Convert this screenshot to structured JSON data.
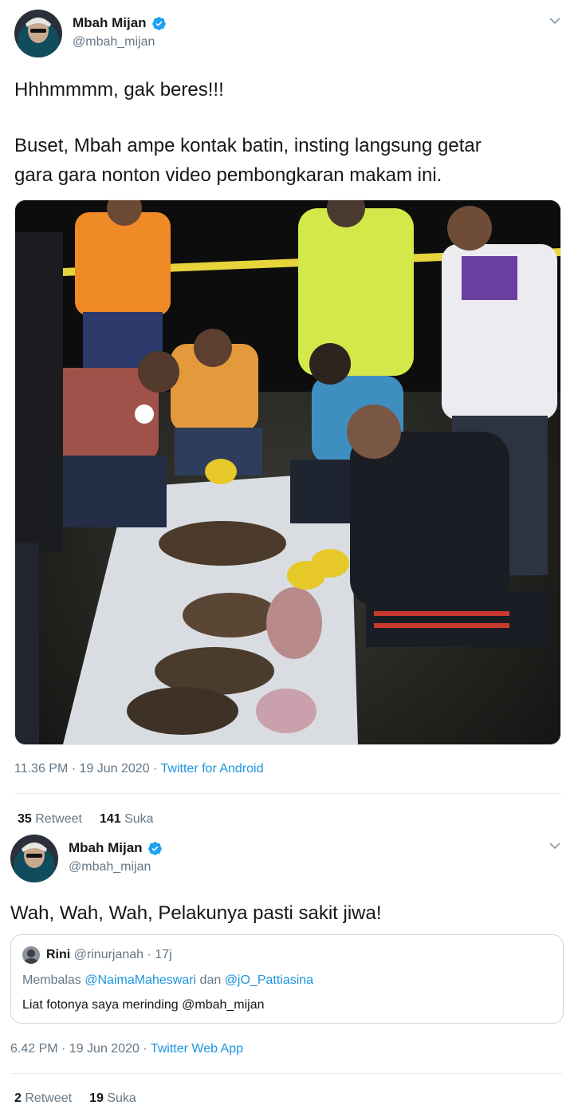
{
  "tweet1": {
    "display_name": "Mbah Mijan",
    "handle": "@mbah_mijan",
    "line1": "Hhhmmmm, gak beres!!!",
    "line2a": "Buset, Mbah ampe kontak batin, insting langsung getar",
    "line2b": "gara gara nonton video pembongkaran makam ini.",
    "time": "11.36 PM · 19 Jun 2020 · ",
    "source": "Twitter for Android",
    "retweets": "35",
    "retweet_label": "Retweet",
    "likes": "141",
    "likes_label": "Suka"
  },
  "tweet2": {
    "display_name": "Mbah Mijan",
    "handle": "@mbah_mijan",
    "text": "Wah, Wah, Wah, Pelakunya pasti sakit jiwa!",
    "quote": {
      "name": "Rini",
      "handle_time": "@rinurjanah · 17j",
      "reply_prefix": "Membalas ",
      "reply_user1": "@NaimaMaheswari",
      "reply_and": " dan ",
      "reply_user2": "@jO_Pattiasina",
      "text": "Liat fotonya saya merinding @mbah_mijan"
    },
    "time": "6.42 PM · 19 Jun 2020 · ",
    "source": "Twitter Web App",
    "retweets": "2",
    "retweet_label": "Retweet",
    "likes": "19",
    "likes_label": "Suka"
  },
  "colors": {
    "link": "#1b95e0",
    "secondary": "#657786",
    "text": "#14171a",
    "verified": "#1da1f2"
  }
}
